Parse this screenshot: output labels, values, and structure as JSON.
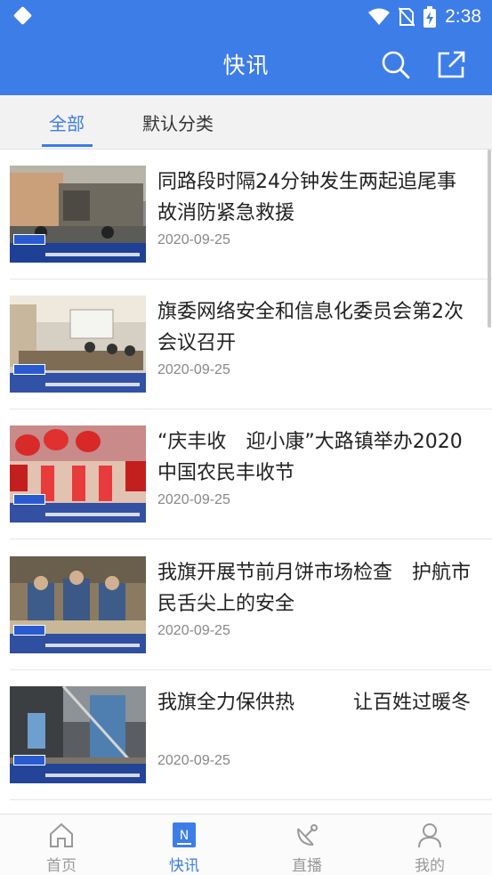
{
  "status_bar": {
    "time": "2:38"
  },
  "app_bar": {
    "title": "快讯",
    "search_icon": "search-icon",
    "share_icon": "share-icon"
  },
  "tabs": [
    {
      "label": "全部",
      "active": true
    },
    {
      "label": "默认分类",
      "active": false
    }
  ],
  "news": [
    {
      "title": "同路段时隔24分钟发生两起追尾事故消防紧急救援",
      "date": "2020-09-25",
      "thumb_theme": "trucks"
    },
    {
      "title": "旗委网络安全和信息化委员会第2次会议召开",
      "date": "2020-09-25",
      "thumb_theme": "meeting"
    },
    {
      "title": "“庆丰收　迎小康”大路镇举办2020中国农民丰收节",
      "date": "2020-09-25",
      "thumb_theme": "festival"
    },
    {
      "title": "我旗开展节前月饼市场检查　护航市民舌尖上的安全",
      "date": "2020-09-25",
      "thumb_theme": "inspection"
    },
    {
      "title": "我旗全力保供热　　　让百姓过暖冬",
      "date": "2020-09-25",
      "thumb_theme": "heating"
    }
  ],
  "bottom_nav": [
    {
      "label": "首页",
      "icon": "home-icon",
      "active": false
    },
    {
      "label": "快讯",
      "icon": "news-icon",
      "active": true
    },
    {
      "label": "直播",
      "icon": "satellite-icon",
      "active": false
    },
    {
      "label": "我的",
      "icon": "user-icon",
      "active": false
    }
  ],
  "colors": {
    "primary": "#3d7de8",
    "inactive": "#999999"
  }
}
